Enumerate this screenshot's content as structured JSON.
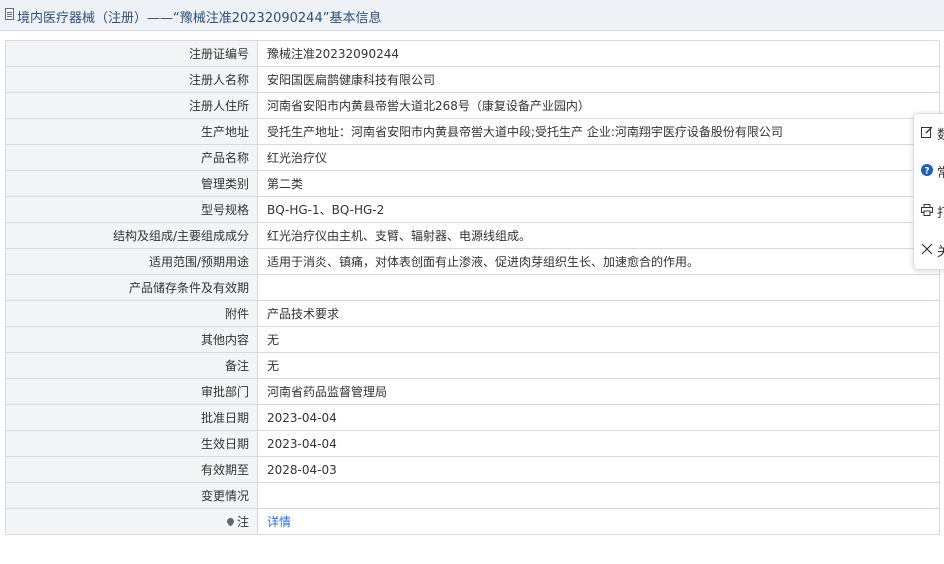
{
  "header": {
    "title": "境内医疗器械（注册）——“豫械注准20232090244”基本信息"
  },
  "rows": [
    {
      "label": "注册证编号",
      "value": "豫械注准20232090244"
    },
    {
      "label": "注册人名称",
      "value": "安阳国医扁鹊健康科技有限公司"
    },
    {
      "label": "注册人住所",
      "value": "河南省安阳市内黄县帝喾大道北268号（康复设备产业园内）"
    },
    {
      "label": "生产地址",
      "value": "受托生产地址：河南省安阳市内黄县帝喾大道中段;受托生产 企业:河南翔宇医疗设备股份有限公司"
    },
    {
      "label": "产品名称",
      "value": "红光治疗仪"
    },
    {
      "label": "管理类别",
      "value": "第二类"
    },
    {
      "label": "型号规格",
      "value": "BQ-HG-1、BQ-HG-2"
    },
    {
      "label": "结构及组成/主要组成成分",
      "value": "红光治疗仪由主机、支臂、辐射器、电源线组成。"
    },
    {
      "label": "适用范围/预期用途",
      "value": "适用于消炎、镇痛，对体表创面有止渗液、促进肉芽组织生长、加速愈合的作用。"
    },
    {
      "label": "产品储存条件及有效期",
      "value": ""
    },
    {
      "label": "附件",
      "value": "产品技术要求"
    },
    {
      "label": "其他内容",
      "value": "无"
    },
    {
      "label": "备注",
      "value": "无"
    },
    {
      "label": "审批部门",
      "value": "河南省药品监督管理局"
    },
    {
      "label": "批准日期",
      "value": "2023-04-04"
    },
    {
      "label": "生效日期",
      "value": "2023-04-04"
    },
    {
      "label": "有效期至",
      "value": "2028-04-03"
    },
    {
      "label": "变更情况",
      "value": ""
    }
  ],
  "note_row": {
    "label": "注",
    "link_text": "详情"
  },
  "side_panel": {
    "items": [
      {
        "label": "数",
        "icon": "edit-icon"
      },
      {
        "label": "常",
        "icon": "help-icon"
      },
      {
        "label": "打",
        "icon": "print-icon"
      },
      {
        "label": "关",
        "icon": "close-icon"
      }
    ]
  },
  "colors": {
    "link": "#2b6fd6",
    "header_bg": "#eef1f5",
    "label_bg": "#f3f4f6",
    "border": "#d6dbe2",
    "help_icon": "#1f5fb8"
  }
}
